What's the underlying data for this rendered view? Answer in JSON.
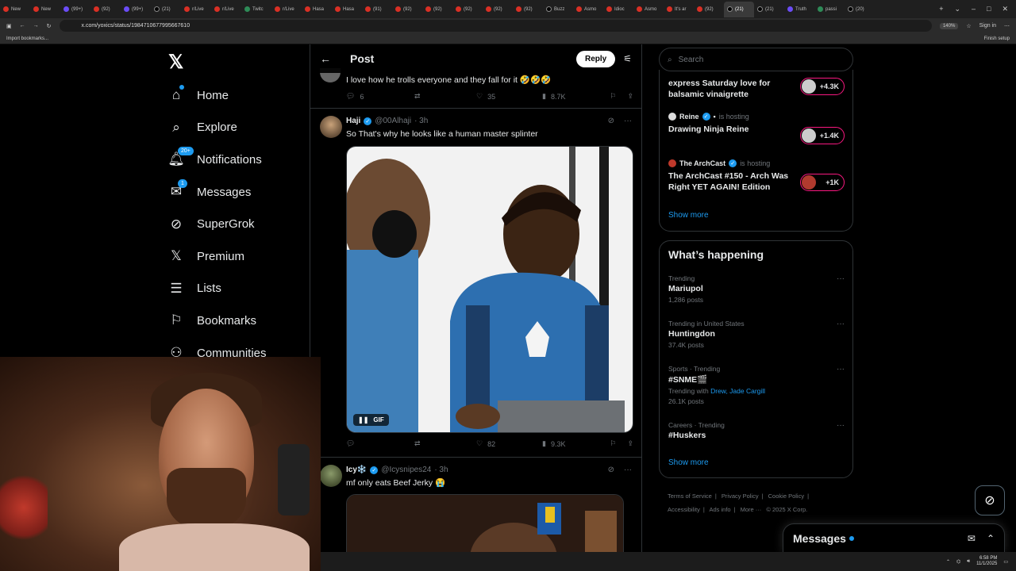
{
  "browser": {
    "tabs": [
      {
        "label": "New",
        "icon": "reddit"
      },
      {
        "label": "New",
        "icon": "reddit"
      },
      {
        "label": "(99+)",
        "icon": "purple"
      },
      {
        "label": "(92)",
        "icon": "reddit"
      },
      {
        "label": "(99+)",
        "icon": "purple"
      },
      {
        "label": "(21)",
        "icon": "x"
      },
      {
        "label": "r/Live",
        "icon": "reddit"
      },
      {
        "label": "r/Live",
        "icon": "reddit"
      },
      {
        "label": "Twitc",
        "icon": "twitch"
      },
      {
        "label": "r/Live",
        "icon": "reddit"
      },
      {
        "label": "Hasa",
        "icon": "reddit"
      },
      {
        "label": "Hasa",
        "icon": "reddit"
      },
      {
        "label": "(91)",
        "icon": "reddit"
      },
      {
        "label": "(92)",
        "icon": "reddit"
      },
      {
        "label": "(92)",
        "icon": "reddit"
      },
      {
        "label": "(92)",
        "icon": "reddit"
      },
      {
        "label": "(92)",
        "icon": "reddit"
      },
      {
        "label": "(92)",
        "icon": "reddit"
      },
      {
        "label": "Buzz",
        "icon": "x"
      },
      {
        "label": "Asmo",
        "icon": "reddit"
      },
      {
        "label": "Idioc",
        "icon": "reddit"
      },
      {
        "label": "Asmo",
        "icon": "reddit"
      },
      {
        "label": "It's ar",
        "icon": "reddit"
      },
      {
        "label": "(92)",
        "icon": "reddit"
      },
      {
        "label": "(21)",
        "icon": "x",
        "active": true
      },
      {
        "label": "(21)",
        "icon": "x"
      },
      {
        "label": "Truth",
        "icon": "purple"
      },
      {
        "label": "passi",
        "icon": "twitch"
      },
      {
        "label": "(20)",
        "icon": "x"
      }
    ],
    "url": "x.com/yoxics/status/1984710677995667610",
    "zoom": "140%",
    "sign_in": "Sign in",
    "bookmarks_import": "Import bookmarks...",
    "finish_setup": "Finish setup"
  },
  "nav": {
    "items": [
      {
        "label": "Home",
        "icon": "home-icon",
        "badge": "dot"
      },
      {
        "label": "Explore",
        "icon": "search-icon"
      },
      {
        "label": "Notifications",
        "icon": "bell-icon",
        "badge": "20+"
      },
      {
        "label": "Messages",
        "icon": "mail-icon",
        "badge": "1"
      },
      {
        "label": "SuperGrok",
        "icon": "grok-icon"
      },
      {
        "label": "Premium",
        "icon": "x-icon"
      },
      {
        "label": "Lists",
        "icon": "list-icon"
      },
      {
        "label": "Bookmarks",
        "icon": "bookmark-icon"
      },
      {
        "label": "Communities",
        "icon": "people-icon"
      }
    ]
  },
  "header": {
    "title": "Post",
    "reply": "Reply"
  },
  "prev_tweet": {
    "text": "I love how he trolls everyone and they fall for it 🤣🤣🤣",
    "replies": "6",
    "retweets": "",
    "likes": "35",
    "views": "8.7K"
  },
  "tweet1": {
    "name": "Haji",
    "handle": "@00Alhaji",
    "time": "· 3h",
    "text": "So That's why he looks like a human master splinter",
    "gif_label": "GIF",
    "replies": "",
    "retweets": "",
    "likes": "82",
    "views": "9.3K"
  },
  "tweet2": {
    "name": "Icy❄️",
    "handle": "@Icysnipes24",
    "time": "· 3h",
    "text": "mf only eats Beef Jerky 😭"
  },
  "search": {
    "placeholder": "Search"
  },
  "spaces": {
    "items": [
      {
        "host": "",
        "hosting": "",
        "title": "express Saturday love for balsamic vinaigrette",
        "count": "+4.3K"
      },
      {
        "host": "Reine",
        "hosting": "is hosting",
        "title": "Drawing Ninja Reine",
        "count": "+1.4K"
      },
      {
        "host": "The ArchCast",
        "hosting": "is hosting",
        "title": "The ArchCast #150 - Arch Was Right YET AGAIN! Edition",
        "count": "+1K"
      }
    ],
    "show_more": "Show more"
  },
  "happening": {
    "title": "What’s happening",
    "trends": [
      {
        "context": "Trending",
        "topic": "Mariupol",
        "count": "1,286 posts"
      },
      {
        "context": "Trending in United States",
        "topic": "Huntingdon",
        "count": "37.4K posts"
      },
      {
        "context": "Sports · Trending",
        "topic": "#SNME🎬",
        "with_label": "Trending with",
        "with_names": "Drew, Jade Cargill",
        "count": "26.1K posts"
      },
      {
        "context": "Careers · Trending",
        "topic": "#Huskers",
        "count": ""
      }
    ],
    "show_more": "Show more"
  },
  "footer": {
    "links": [
      "Terms of Service",
      "|",
      "Privacy Policy",
      "|",
      "Cookie Policy",
      "|",
      "Accessibility",
      "|",
      "Ads info",
      "|",
      "More ···",
      "© 2025 X Corp."
    ]
  },
  "messages_drawer": {
    "title": "Messages"
  },
  "taskbar": {
    "time": "6:58 PM",
    "date": "11/1/2025"
  },
  "colors": {
    "accent": "#1d9bf0",
    "live_pink": "#f91880",
    "border": "#2f3336",
    "muted": "#71767b"
  }
}
